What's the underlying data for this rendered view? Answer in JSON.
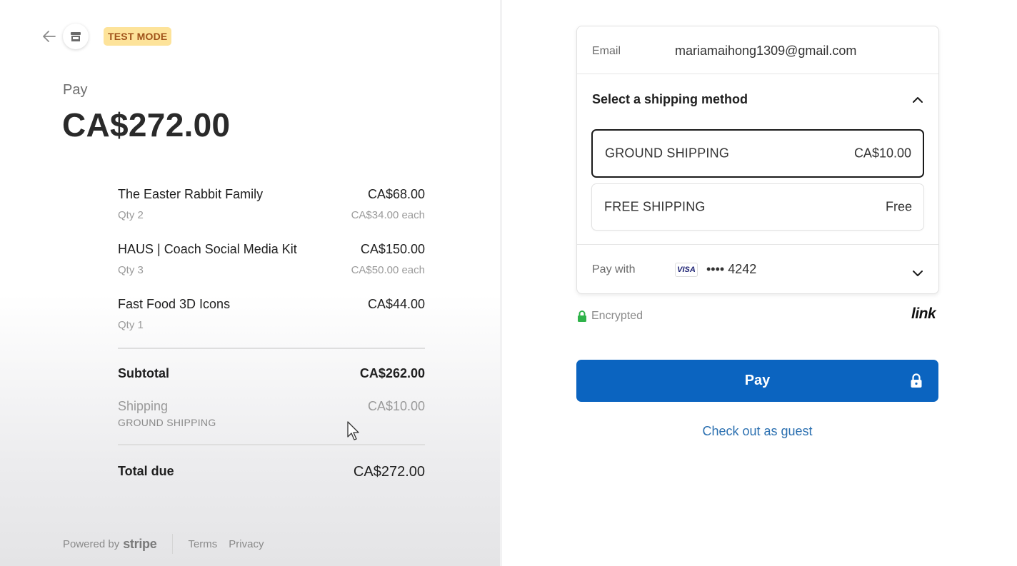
{
  "header": {
    "test_mode_label": "TEST MODE"
  },
  "summary": {
    "pay_label": "Pay",
    "amount": "CA$272.00",
    "items": [
      {
        "name": "The Easter Rabbit Family",
        "price": "CA$68.00",
        "qty": "Qty 2",
        "each": "CA$34.00 each"
      },
      {
        "name": "HAUS | Coach Social Media Kit",
        "price": "CA$150.00",
        "qty": "Qty 3",
        "each": "CA$50.00 each"
      },
      {
        "name": "Fast Food 3D Icons",
        "price": "CA$44.00",
        "qty": "Qty 1",
        "each": ""
      }
    ],
    "subtotal_label": "Subtotal",
    "subtotal_value": "CA$262.00",
    "shipping_label": "Shipping",
    "shipping_method": "GROUND SHIPPING",
    "shipping_value": "CA$10.00",
    "total_label": "Total due",
    "total_value": "CA$272.00"
  },
  "footer": {
    "powered_by": "Powered by",
    "brand": "stripe",
    "terms": "Terms",
    "privacy": "Privacy"
  },
  "checkout": {
    "email_label": "Email",
    "email_value": "mariamaihong1309@gmail.com",
    "shipping_header": "Select a shipping method",
    "shipping_options": [
      {
        "name": "GROUND SHIPPING",
        "price": "CA$10.00",
        "selected": true
      },
      {
        "name": "FREE SHIPPING",
        "price": "Free",
        "selected": false
      }
    ],
    "pay_with_label": "Pay with",
    "card_brand": "VISA",
    "card_number": "•••• 4242",
    "encrypted_label": "Encrypted",
    "link_logo": "link",
    "pay_button": "Pay",
    "guest_link": "Check out as guest"
  },
  "colors": {
    "accent": "#0b64c0",
    "badge_bg": "#fde39a",
    "badge_text": "#a0531a",
    "lock_green": "#2fb34a"
  }
}
